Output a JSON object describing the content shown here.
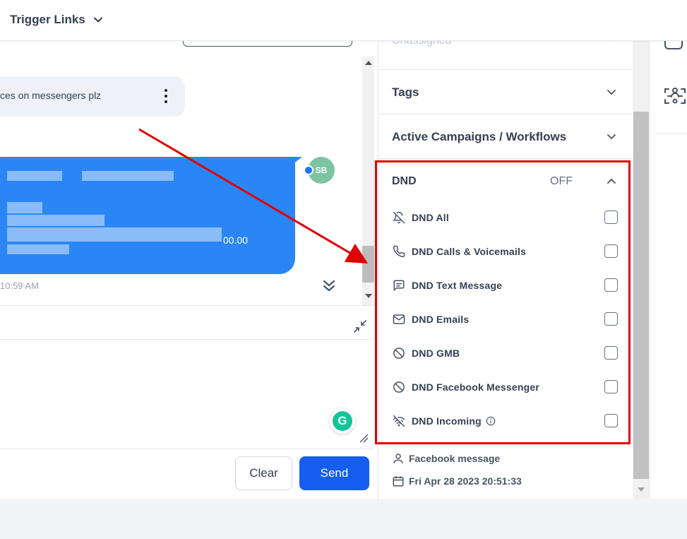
{
  "header": {
    "menu_label": "Trigger Links"
  },
  "chat": {
    "incoming_message": "ces on messengers plz",
    "outgoing_amount_fragment": "00.00",
    "avatar_initials": "SB",
    "timestamp": "10:59 AM",
    "buttons": {
      "clear": "Clear",
      "send": "Send"
    },
    "brand_color": "#2b86f5",
    "send_color": "#155eef"
  },
  "panel": {
    "assigned_placeholder": "Unassigned",
    "sections": {
      "tags": "Tags",
      "campaigns": "Active Campaigns / Workflows"
    },
    "dnd": {
      "title": "DND",
      "status": "OFF",
      "items": [
        {
          "label": "DND All",
          "icon": "bell-off-icon",
          "checked": false
        },
        {
          "label": "DND Calls & Voicemails",
          "icon": "phone-icon",
          "checked": false
        },
        {
          "label": "DND Text Message",
          "icon": "message-square-icon",
          "checked": false
        },
        {
          "label": "DND Emails",
          "icon": "mail-icon",
          "checked": false
        },
        {
          "label": "DND GMB",
          "icon": "ban-icon",
          "checked": false
        },
        {
          "label": "DND Facebook Messenger",
          "icon": "ban-icon",
          "checked": false
        },
        {
          "label": "DND Incoming",
          "icon": "wifi-off-icon",
          "checked": false
        }
      ]
    },
    "source_label": "Facebook message",
    "created_date": "Fri Apr 28 2023 20:51:33"
  },
  "annotation": {
    "highlight_color": "#e00000"
  }
}
